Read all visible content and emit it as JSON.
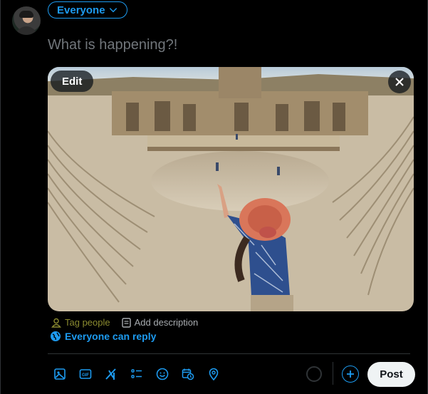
{
  "audience": {
    "label": "Everyone"
  },
  "composer": {
    "placeholder": "What is happening?!"
  },
  "media": {
    "edit_label": "Edit",
    "image_alt": "Woman in a red hat raising her hand over an ancient Roman theater"
  },
  "media_actions": {
    "tag_people": "Tag people",
    "add_description": "Add description"
  },
  "reply_setting": {
    "label": "Everyone can reply"
  },
  "toolbar": {
    "tools": [
      "media-icon",
      "gif-icon",
      "grok-icon",
      "poll-icon",
      "emoji-icon",
      "schedule-icon",
      "location-icon"
    ]
  },
  "post": {
    "label": "Post"
  },
  "colors": {
    "accent": "#1d9bf0",
    "background": "#000000",
    "muted": "#71767b"
  }
}
